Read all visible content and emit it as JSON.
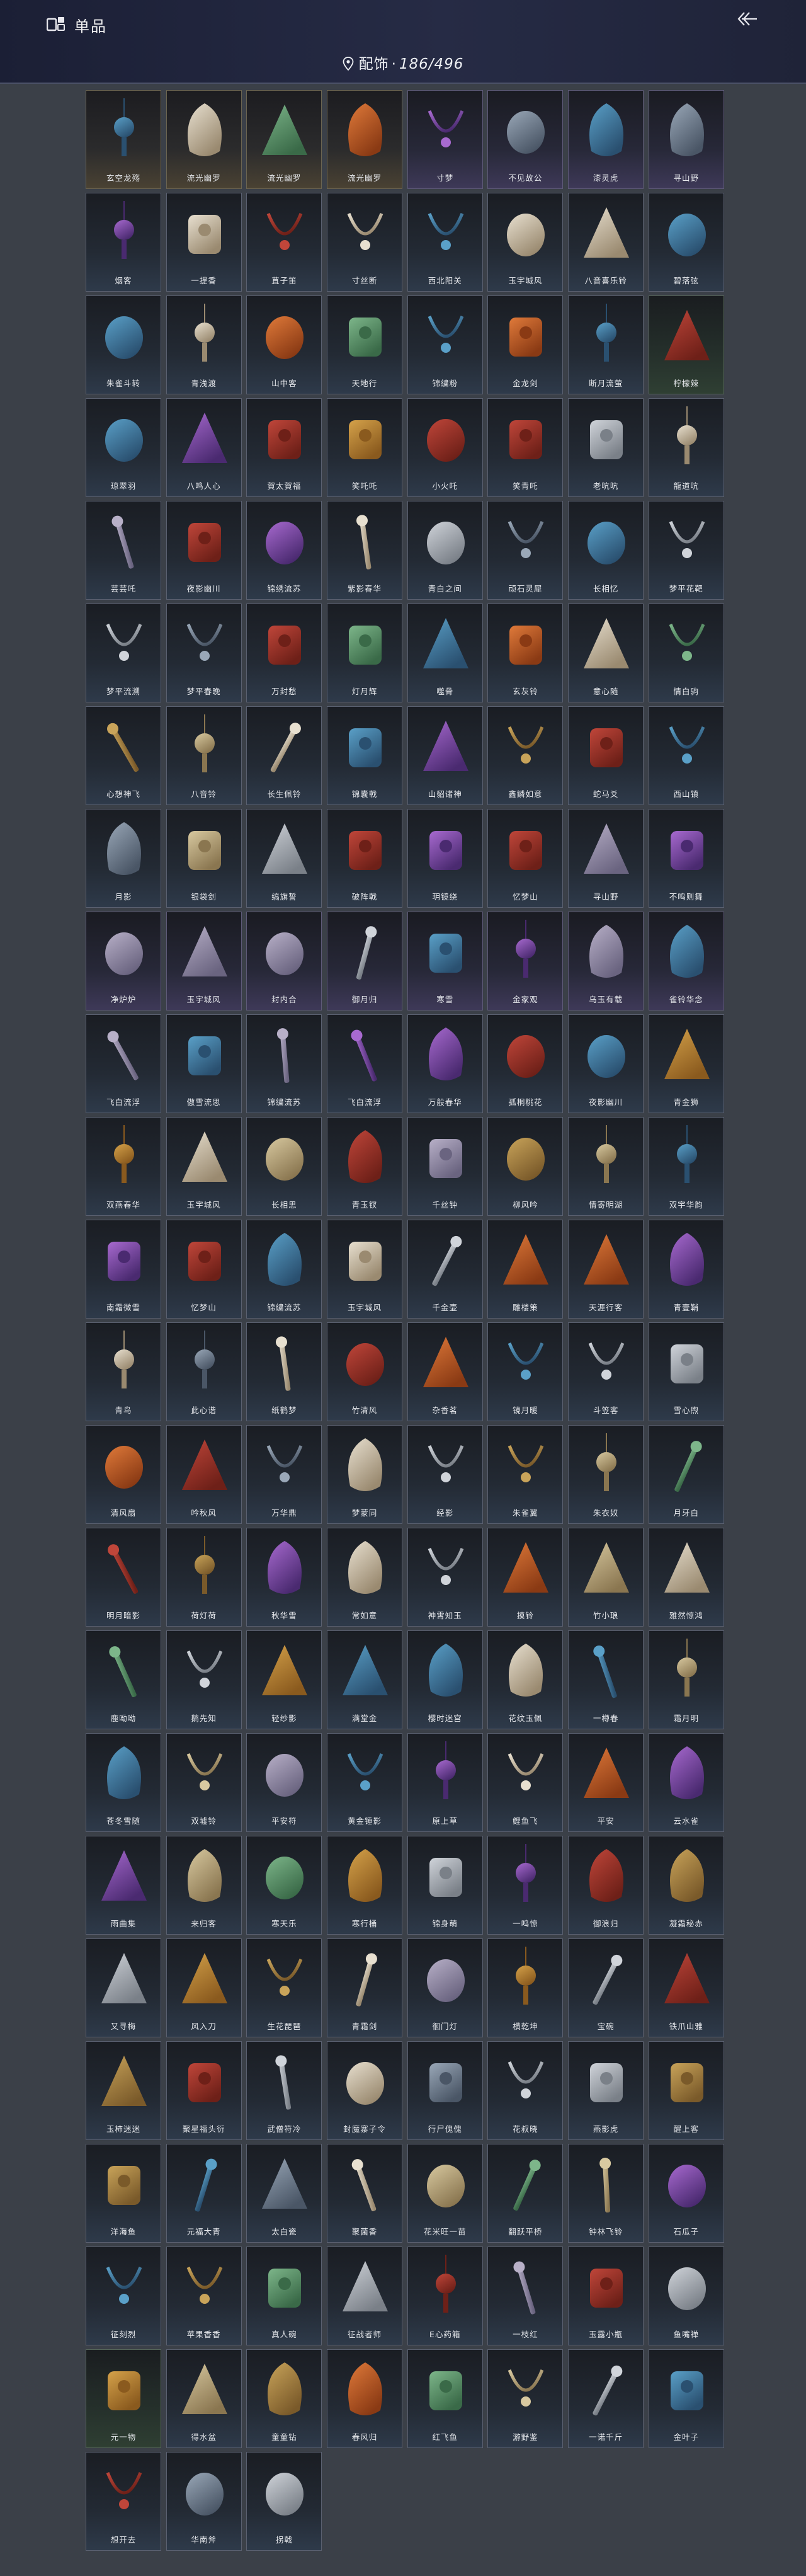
{
  "header": {
    "title": "单品",
    "back_icon": "back-arrow-icon",
    "logo_icon": "app-logo-icon"
  },
  "counter": {
    "category": "配饰",
    "separator": "·",
    "owned": "186",
    "total": "496"
  },
  "colors": {
    "gold_tier": "#4a4233",
    "purple_tier": "#3e3958",
    "blue_tier": "#2e3a4a",
    "green_tier": "#2f3f33",
    "header_bg": "#1b1f35",
    "page_bg": "#3b4048"
  },
  "items": [
    {
      "label": "玄空龙殇",
      "icon": "lightning-wand-icon",
      "tier": "gold"
    },
    {
      "label": "流光幽罗",
      "icon": "purple-aura-icon",
      "tier": "gold"
    },
    {
      "label": "流光幽罗",
      "icon": "gold-chain-icon",
      "tier": "gold"
    },
    {
      "label": "流光幽罗",
      "icon": "purple-wings-icon",
      "tier": "gold"
    },
    {
      "label": "寸梦",
      "icon": "dark-sword-icon",
      "tier": "purple"
    },
    {
      "label": "不见故公",
      "icon": "brush-hand-icon",
      "tier": "purple"
    },
    {
      "label": "漆灵虎",
      "icon": "silver-claw-icon",
      "tier": "purple"
    },
    {
      "label": "寻山野",
      "icon": "red-drum-icon",
      "tier": "purple"
    },
    {
      "label": "烟客",
      "icon": "dagger-icon",
      "tier": "blue"
    },
    {
      "label": "一提香",
      "icon": "incense-burner-icon",
      "tier": "blue"
    },
    {
      "label": "苴子笛",
      "icon": "flute-icon",
      "tier": "blue"
    },
    {
      "label": "寸丝断",
      "icon": "umbrella-icon",
      "tier": "blue"
    },
    {
      "label": "西北阳关",
      "icon": "gourd-icon",
      "tier": "blue"
    },
    {
      "label": "玉宇城风",
      "icon": "ornate-pipe-icon",
      "tier": "blue"
    },
    {
      "label": "八音喜乐铃",
      "icon": "bell-cluster-icon",
      "tier": "blue"
    },
    {
      "label": "碧落弦",
      "icon": "long-flute-icon",
      "tier": "blue"
    },
    {
      "label": "朱雀斗转",
      "icon": "red-feather-icon",
      "tier": "blue"
    },
    {
      "label": "青浅渡",
      "icon": "twin-blades-icon",
      "tier": "blue"
    },
    {
      "label": "山中客",
      "icon": "armor-icon",
      "tier": "blue"
    },
    {
      "label": "天地行",
      "icon": "backpack-icon",
      "tier": "blue"
    },
    {
      "label": "锦繍粉",
      "icon": "golden-beast-icon",
      "tier": "blue"
    },
    {
      "label": "金龙剑",
      "icon": "scissors-icon",
      "tier": "blue"
    },
    {
      "label": "断月流萤",
      "icon": "red-dragon-icon",
      "tier": "blue"
    },
    {
      "label": "柠檬辣",
      "icon": "green-lantern-icon",
      "tier": "green"
    },
    {
      "label": "琼翠羽",
      "icon": "golden-crown-icon",
      "tier": "blue"
    },
    {
      "label": "八鸣人心",
      "icon": "bronze-bell-icon",
      "tier": "blue"
    },
    {
      "label": "賀太賀福",
      "icon": "pink-bird-icon",
      "tier": "blue"
    },
    {
      "label": "笑吒吒",
      "icon": "red-bird-icon",
      "tier": "blue"
    },
    {
      "label": "小火吒",
      "icon": "red-chick-icon",
      "tier": "blue"
    },
    {
      "label": "笑青吒",
      "icon": "white-chick-icon",
      "tier": "blue"
    },
    {
      "label": "老吭吭",
      "icon": "white-bird-icon",
      "tier": "blue"
    },
    {
      "label": "龍道吭",
      "icon": "golden-lion-icon",
      "tier": "blue"
    },
    {
      "label": "芸芸吒",
      "icon": "green-orb-icon",
      "tier": "blue"
    },
    {
      "label": "夜影幽川",
      "icon": "dark-blob-icon",
      "tier": "blue"
    },
    {
      "label": "锦绣流苏",
      "icon": "necklace-icon",
      "tier": "blue"
    },
    {
      "label": "紫影春华",
      "icon": "purple-flower-icon",
      "tier": "blue"
    },
    {
      "label": "青白之间",
      "icon": "silver-chain-icon",
      "tier": "blue"
    },
    {
      "label": "顽石灵犀",
      "icon": "antler-icon",
      "tier": "blue"
    },
    {
      "label": "长相忆",
      "icon": "teal-staff-icon",
      "tier": "blue"
    },
    {
      "label": "梦平花靶",
      "icon": "fish-ornament-icon",
      "tier": "blue"
    },
    {
      "label": "梦平流溯",
      "icon": "dark-staff-icon",
      "tier": "blue"
    },
    {
      "label": "梦平春晚",
      "icon": "red-lantern-icon",
      "tier": "blue"
    },
    {
      "label": "万封愁",
      "icon": "tassel-icon",
      "tier": "blue"
    },
    {
      "label": "灯月辉",
      "icon": "lamp-icon",
      "tier": "blue"
    },
    {
      "label": "噬骨",
      "icon": "bone-blade-icon",
      "tier": "blue"
    },
    {
      "label": "玄灰铃",
      "icon": "gold-bead-icon",
      "tier": "blue"
    },
    {
      "label": "意心随",
      "icon": "pendant-icon",
      "tier": "blue"
    },
    {
      "label": "情白驹",
      "icon": "white-tassel-icon",
      "tier": "blue"
    },
    {
      "label": "心想神飞",
      "icon": "red-ribbon-icon",
      "tier": "blue"
    },
    {
      "label": "八音铃",
      "icon": "jade-pendant-icon",
      "tier": "blue"
    },
    {
      "label": "长生佩铃",
      "icon": "red-knot-icon",
      "tier": "blue"
    },
    {
      "label": "锦囊戟",
      "icon": "red-drapery-icon",
      "tier": "blue"
    },
    {
      "label": "山貂诸神",
      "icon": "eye-amulet-icon",
      "tier": "blue"
    },
    {
      "label": "鑫鳞如意",
      "icon": "coin-lantern-icon",
      "tier": "blue"
    },
    {
      "label": "蛇马爻",
      "icon": "fish-kite-icon",
      "tier": "blue"
    },
    {
      "label": "西山镇",
      "icon": "dark-weapon-icon",
      "tier": "blue"
    },
    {
      "label": "月影",
      "icon": "gloves-icon",
      "tier": "blue"
    },
    {
      "label": "银袋剑",
      "icon": "bamboo-flute-icon",
      "tier": "blue"
    },
    {
      "label": "缟旗誓",
      "icon": "war-flag-icon",
      "tier": "blue"
    },
    {
      "label": "破阵戟",
      "icon": "halberd-icon",
      "tier": "blue"
    },
    {
      "label": "玥镜绕",
      "icon": "hanging-charm-icon",
      "tier": "blue"
    },
    {
      "label": "忆梦山",
      "icon": "bird-cage-icon",
      "tier": "blue"
    },
    {
      "label": "寻山野",
      "icon": "red-scarf-icon",
      "tier": "blue"
    },
    {
      "label": "不鸣则舞",
      "icon": "tiger-mask-icon",
      "tier": "blue"
    },
    {
      "label": "净炉炉",
      "icon": "broom-icon",
      "tier": "purple"
    },
    {
      "label": "玉宇城风",
      "icon": "silver-sword-icon",
      "tier": "purple"
    },
    {
      "label": "封内合",
      "icon": "red-spear-icon",
      "tier": "purple"
    },
    {
      "label": "御月归",
      "icon": "moon-disk-icon",
      "tier": "purple"
    },
    {
      "label": "寒雪",
      "icon": "wind-chime-icon",
      "tier": "purple"
    },
    {
      "label": "金家观",
      "icon": "red-bucket-icon",
      "tier": "purple"
    },
    {
      "label": "乌玉有载",
      "icon": "dark-stones-icon",
      "tier": "purple"
    },
    {
      "label": "雀铃华念",
      "icon": "white-fur-icon",
      "tier": "purple"
    },
    {
      "label": "飞白流浮",
      "icon": "mechanism-icon",
      "tier": "blue"
    },
    {
      "label": "傲雪流思",
      "icon": "wing-clasp-icon",
      "tier": "blue"
    },
    {
      "label": "锦繍流苏",
      "icon": "head-ornament-icon",
      "tier": "blue"
    },
    {
      "label": "飞白流浮",
      "icon": "silver-headpiece-icon",
      "tier": "blue"
    },
    {
      "label": "万般春华",
      "icon": "hair-pin-icon",
      "tier": "blue"
    },
    {
      "label": "孤桐桃花",
      "icon": "red-leaves-icon",
      "tier": "blue"
    },
    {
      "label": "夜影幽川",
      "icon": "golden-crown-icon",
      "tier": "blue"
    },
    {
      "label": "青金狮",
      "icon": "lion-statue-icon",
      "tier": "blue"
    },
    {
      "label": "双燕春华",
      "icon": "pink-flowers-icon",
      "tier": "blue"
    },
    {
      "label": "玉宇城风",
      "icon": "gold-coil-icon",
      "tier": "blue"
    },
    {
      "label": "长相思",
      "icon": "silver-armor-icon",
      "tier": "blue"
    },
    {
      "label": "青玉钗",
      "icon": "grey-bow-icon",
      "tier": "blue"
    },
    {
      "label": "千丝钟",
      "icon": "gold-tassel-icon",
      "tier": "blue"
    },
    {
      "label": "柳风吟",
      "icon": "snowflake-icon",
      "tier": "blue"
    },
    {
      "label": "情寄明湖",
      "icon": "orange-lantern-icon",
      "tier": "blue"
    },
    {
      "label": "双宇华韵",
      "icon": "blue-lantern-icon",
      "tier": "blue"
    },
    {
      "label": "南霜微雪",
      "icon": "dark-drop-icon",
      "tier": "blue"
    },
    {
      "label": "忆梦山",
      "icon": "silver-chime-icon",
      "tier": "blue"
    },
    {
      "label": "锦繍流苏",
      "icon": "red-charm-icon",
      "tier": "blue"
    },
    {
      "label": "玉宇城风",
      "icon": "white-chime-icon",
      "tier": "blue"
    },
    {
      "label": "千金壶",
      "icon": "teapot-icon",
      "tier": "blue"
    },
    {
      "label": "雕楼策",
      "icon": "dark-ornament-icon",
      "tier": "blue"
    },
    {
      "label": "天涯行客",
      "icon": "camp-gear-icon",
      "tier": "blue"
    },
    {
      "label": "青壹鞘",
      "icon": "scabbard-icon",
      "tier": "blue"
    },
    {
      "label": "青鸟",
      "icon": "round-shield-icon",
      "tier": "blue"
    },
    {
      "label": "此心谐",
      "icon": "white-cord-icon",
      "tier": "blue"
    },
    {
      "label": "纸鹤梦",
      "icon": "paper-crane-icon",
      "tier": "blue"
    },
    {
      "label": "竹清风",
      "icon": "round-fan-icon",
      "tier": "blue"
    },
    {
      "label": "杂香茗",
      "icon": "thin-charm-icon",
      "tier": "blue"
    },
    {
      "label": "镜月暖",
      "icon": "silver-mirror-icon",
      "tier": "blue"
    },
    {
      "label": "斗笠客",
      "icon": "straw-hat-icon",
      "tier": "blue"
    },
    {
      "label": "雪心煦",
      "icon": "pearl-necklace-icon",
      "tier": "blue"
    },
    {
      "label": "清风扇",
      "icon": "moon-fan-icon",
      "tier": "blue"
    },
    {
      "label": "吟秋风",
      "icon": "leaf-fan-icon",
      "tier": "blue"
    },
    {
      "label": "万华鼎",
      "icon": "cauldron-icon",
      "tier": "blue"
    },
    {
      "label": "梦蒙同",
      "icon": "flower-basket-icon",
      "tier": "blue"
    },
    {
      "label": "经影",
      "icon": "book-scroll-icon",
      "tier": "blue"
    },
    {
      "label": "朱雀翼",
      "icon": "grey-staff-icon",
      "tier": "blue"
    },
    {
      "label": "朱衣奴",
      "icon": "red-doll-icon",
      "tier": "blue"
    },
    {
      "label": "月牙白",
      "icon": "curved-blade-icon",
      "tier": "blue"
    },
    {
      "label": "明月暗影",
      "icon": "crescent-pendant-icon",
      "tier": "blue"
    },
    {
      "label": "荷灯荷",
      "icon": "lantern-icon",
      "tier": "blue"
    },
    {
      "label": "秋华雪",
      "icon": "jade-orb-icon",
      "tier": "blue"
    },
    {
      "label": "常如意",
      "icon": "red-tassel-icon",
      "tier": "blue"
    },
    {
      "label": "神霄知玉",
      "icon": "blue-chime-icon",
      "tier": "blue"
    },
    {
      "label": "摸铃",
      "icon": "round-ornament-icon",
      "tier": "blue"
    },
    {
      "label": "竹小琅",
      "icon": "spear-tip-icon",
      "tier": "blue"
    },
    {
      "label": "雅然惊鸿",
      "icon": "red-ornament-icon",
      "tier": "blue"
    },
    {
      "label": "鹿呦呦",
      "icon": "puppet-icon",
      "tier": "blue"
    },
    {
      "label": "鹅先知",
      "icon": "goose-icon",
      "tier": "blue"
    },
    {
      "label": "轻纱影",
      "icon": "paper-umbrella-icon",
      "tier": "blue"
    },
    {
      "label": "满堂金",
      "icon": "gold-pendant-icon",
      "tier": "blue"
    },
    {
      "label": "樱时迷宫",
      "icon": "red-charm-icon",
      "tier": "blue"
    },
    {
      "label": "花纹玉佩",
      "icon": "beaded-loop-icon",
      "tier": "blue"
    },
    {
      "label": "一樽春",
      "icon": "blue-tassel-icon",
      "tier": "blue"
    },
    {
      "label": "霜月明",
      "icon": "moon-mirror-icon",
      "tier": "blue"
    },
    {
      "label": "苍冬雪随",
      "icon": "red-charm-icon",
      "tier": "blue"
    },
    {
      "label": "双墟铃",
      "icon": "brown-tassel-icon",
      "tier": "blue"
    },
    {
      "label": "平安符",
      "icon": "dark-pendant-icon",
      "tier": "blue"
    },
    {
      "label": "黄金锤影",
      "icon": "gold-burst-icon",
      "tier": "blue"
    },
    {
      "label": "原上草",
      "icon": "horn-ornament-icon",
      "tier": "blue"
    },
    {
      "label": "鲤鱼飞",
      "icon": "golden-torch-icon",
      "tier": "blue"
    },
    {
      "label": "平安",
      "icon": "dark-lantern-icon",
      "tier": "blue"
    },
    {
      "label": "云水雀",
      "icon": "blue-kite-icon",
      "tier": "blue"
    },
    {
      "label": "雨曲集",
      "icon": "dark-fern-icon",
      "tier": "blue"
    },
    {
      "label": "来归客",
      "icon": "dark-brush-icon",
      "tier": "blue"
    },
    {
      "label": "寒天乐",
      "icon": "gold-bell-icon",
      "tier": "blue"
    },
    {
      "label": "寒行桶",
      "icon": "wooden-barrel-icon",
      "tier": "blue"
    },
    {
      "label": "锦身萌",
      "icon": "flower-wreath-icon",
      "tier": "blue"
    },
    {
      "label": "一鸣惊",
      "icon": "crimson-blade-icon",
      "tier": "blue"
    },
    {
      "label": "御浪归",
      "icon": "koi-fish-icon",
      "tier": "blue"
    },
    {
      "label": "凝霜秘赤",
      "icon": "bull-head-icon",
      "tier": "blue"
    },
    {
      "label": "又寻梅",
      "icon": "dark-blade-icon",
      "tier": "blue"
    },
    {
      "label": "风入刀",
      "icon": "curved-sword-icon",
      "tier": "blue"
    },
    {
      "label": "生花琵琶",
      "icon": "pipa-icon",
      "tier": "blue"
    },
    {
      "label": "青霜剑",
      "icon": "bamboo-sword-icon",
      "tier": "blue"
    },
    {
      "label": "徊门灯",
      "icon": "paper-lantern-icon",
      "tier": "blue"
    },
    {
      "label": "横乾坤",
      "icon": "small-charm-icon",
      "tier": "blue"
    },
    {
      "label": "宝碗",
      "icon": "tea-cup-icon",
      "tier": "blue"
    },
    {
      "label": "铁爪山雅",
      "icon": "claw-gauntlet-icon",
      "tier": "blue"
    },
    {
      "label": "玉柿迷迷",
      "icon": "persimmon-icon",
      "tier": "blue"
    },
    {
      "label": "聚星福头衍",
      "icon": "black-cap-icon",
      "tier": "blue"
    },
    {
      "label": "武僧符冷",
      "icon": "gold-plaque-icon",
      "tier": "blue"
    },
    {
      "label": "封魔寨子令",
      "icon": "dark-rod-icon",
      "tier": "blue"
    },
    {
      "label": "行尸傀傀",
      "icon": "stone-tablet-icon",
      "tier": "blue"
    },
    {
      "label": "花叔晓",
      "icon": "bead-necklace-icon",
      "tier": "blue"
    },
    {
      "label": "燕影虎",
      "icon": "red-collar-icon",
      "tier": "blue"
    },
    {
      "label": "醒上客",
      "icon": "pink-peony-icon",
      "tier": "blue"
    },
    {
      "label": "洋海鱼",
      "icon": "starfish-icon",
      "tier": "blue"
    },
    {
      "label": "元福大青",
      "icon": "panda-mask-icon",
      "tier": "blue"
    },
    {
      "label": "太白瓷",
      "icon": "opera-mask-icon",
      "tier": "blue"
    },
    {
      "label": "聚菌香",
      "icon": "mushroom-icon",
      "tier": "blue"
    },
    {
      "label": "花米旺一苗",
      "icon": "red-flower-icon",
      "tier": "blue"
    },
    {
      "label": "翻跃平桥",
      "icon": "long-spear-icon",
      "tier": "blue"
    },
    {
      "label": "钟林飞铃",
      "icon": "thin-dart-icon",
      "tier": "blue"
    },
    {
      "label": "石瓜子",
      "icon": "cucumber-icon",
      "tier": "blue"
    },
    {
      "label": "征刻烈",
      "icon": "crossed-axes-icon",
      "tier": "blue"
    },
    {
      "label": "苹果香香",
      "icon": "red-apple-icon",
      "tier": "blue"
    },
    {
      "label": "真人碗",
      "icon": "lacquer-bowl-icon",
      "tier": "blue"
    },
    {
      "label": "征战者师",
      "icon": "war-banner-icon",
      "tier": "blue"
    },
    {
      "label": "E心药箱",
      "icon": "medicine-box-icon",
      "tier": "blue"
    },
    {
      "label": "一枝红",
      "icon": "red-beads-icon",
      "tier": "blue"
    },
    {
      "label": "玉露小瓶",
      "icon": "blue-flask-icon",
      "tier": "blue"
    },
    {
      "label": "鱼嘴禅",
      "icon": "fish-head-icon",
      "tier": "blue"
    },
    {
      "label": "元一物",
      "icon": "black-box-icon",
      "tier": "green"
    },
    {
      "label": "得水盆",
      "icon": "clay-jar-icon",
      "tier": "blue"
    },
    {
      "label": "童童钻",
      "icon": "bone-drill-icon",
      "tier": "blue"
    },
    {
      "label": "春风归",
      "icon": "silver-kite-icon",
      "tier": "blue"
    },
    {
      "label": "红飞鱼",
      "icon": "red-fish-kite-icon",
      "tier": "blue"
    },
    {
      "label": "游野鉴",
      "icon": "iron-claws-icon",
      "tier": "blue"
    },
    {
      "label": "一诺千斤",
      "icon": "roast-chicken-icon",
      "tier": "blue"
    },
    {
      "label": "金叶子",
      "icon": "gold-leaf-icon",
      "tier": "blue"
    },
    {
      "label": "想开去",
      "icon": "kitchen-knife-icon",
      "tier": "blue"
    },
    {
      "label": "华南斧",
      "icon": "axe-icon",
      "tier": "blue"
    },
    {
      "label": "拐戟",
      "icon": "dark-halberd-icon",
      "tier": "blue"
    }
  ]
}
